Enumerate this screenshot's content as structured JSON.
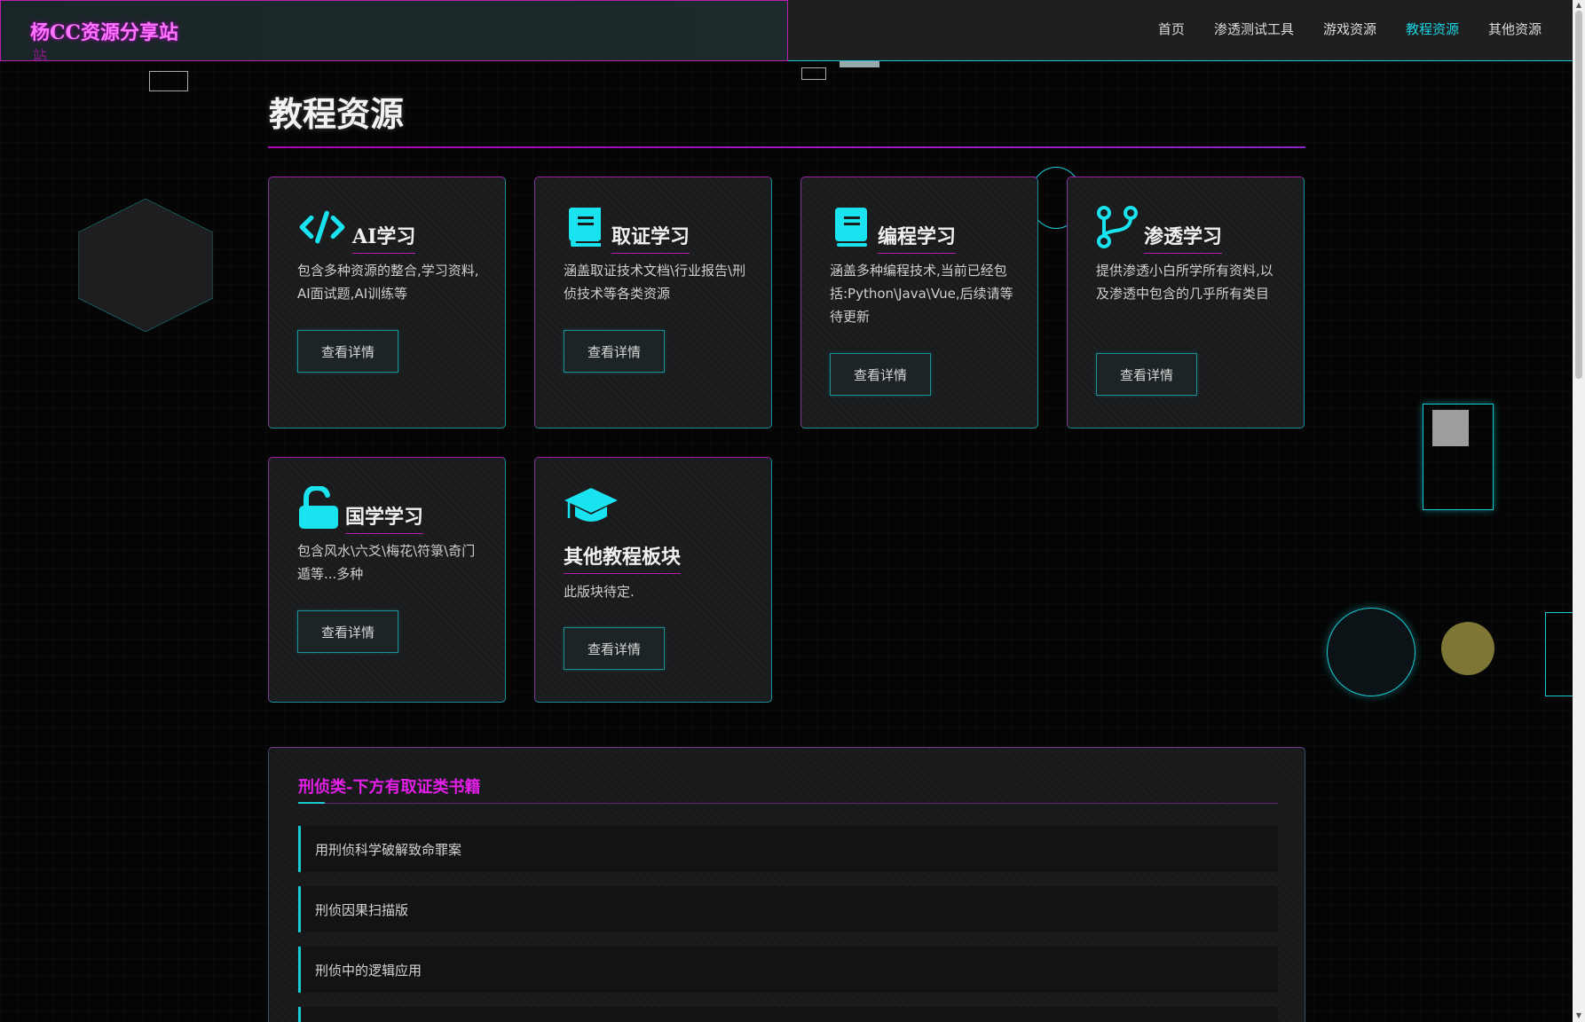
{
  "header": {
    "brand": "杨CC资源分享站",
    "brand_ghost": "站",
    "nav": [
      "首页",
      "渗透测试工具",
      "游戏资源",
      "教程资源",
      "其他资源"
    ],
    "active_nav": "教程资源"
  },
  "page_title": "教程资源",
  "cards": [
    {
      "icon": "code-icon",
      "title": "AI学习",
      "desc": "包含多种资源的整合,学习资料, AI面试题,AI训练等",
      "button": "查看详情"
    },
    {
      "icon": "book-icon",
      "title": "取证学习",
      "desc": "涵盖取证技术文档\\行业报告\\刑侦技术等各类资源",
      "button": "查看详情"
    },
    {
      "icon": "book-icon",
      "title": "编程学习",
      "desc": "涵盖多种编程技术,当前已经包括:Python\\Java\\Vue,后续请等待更新",
      "button": "查看详情"
    },
    {
      "icon": "code-branch-icon",
      "title": "渗透学习",
      "desc": "提供渗透小白所学所有资料,以及渗透中包含的几乎所有类目",
      "button": "查看详情"
    },
    {
      "icon": "unlock-icon",
      "title": "国学学习",
      "desc": "包含风水\\六爻\\梅花\\符箓\\奇门遁等...多种",
      "button": "查看详情"
    },
    {
      "icon": "graduation-cap-icon",
      "title": "其他教程板块",
      "desc": "此版块待定.",
      "button": "查看详情"
    }
  ],
  "panel": {
    "title": "刑侦类-下方有取证类书籍",
    "books": [
      "用刑侦科学破解致命罪案",
      "刑侦因果扫描版",
      "刑侦中的逻辑应用"
    ]
  },
  "colors": {
    "accent": "#19c9d1",
    "brand": "#ff74ff",
    "border_purple": "#b81fb0"
  }
}
